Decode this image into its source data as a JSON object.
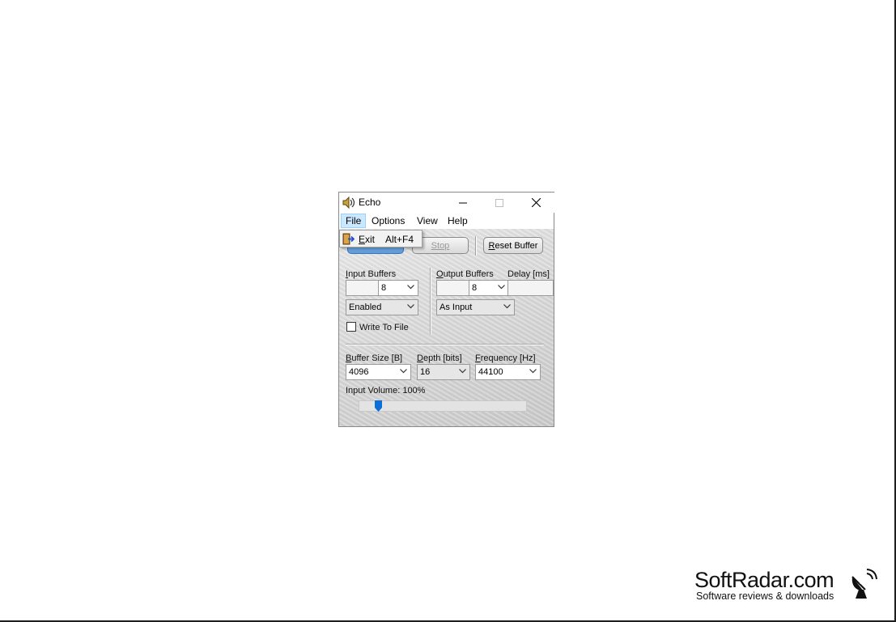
{
  "window": {
    "title": "Echo",
    "menu": [
      "File",
      "Options",
      "View",
      "Help"
    ]
  },
  "file_menu": {
    "exit_label": "Exit",
    "exit_shortcut": "Alt+F4"
  },
  "toolbar": {
    "play_label": "",
    "stop_label": "Stop",
    "reset_label": "Reset Buffer"
  },
  "input": {
    "label": "Input Buffers",
    "buffers_value": "8",
    "mode_value": "Enabled",
    "write_to_file_label": "Write To File",
    "write_to_file_checked": false
  },
  "output": {
    "label": "Output Buffers",
    "delay_label": "Delay [ms]",
    "buffers_value": "8",
    "mode_value": "As Input"
  },
  "audio": {
    "buffer_size_label": "Buffer Size [B]",
    "buffer_size_value": "4096",
    "depth_label": "Depth [bits]",
    "depth_value": "16",
    "frequency_label": "Frequency [Hz]",
    "frequency_value": "44100",
    "volume_label": "Input Volume: 100%",
    "volume_fraction": 0.1
  },
  "watermark": {
    "title": "SoftRadar.com",
    "subtitle": "Software reviews & downloads"
  },
  "colors": {
    "menu_highlight": "#cce8ff",
    "slider_thumb": "#0a6fd6"
  }
}
